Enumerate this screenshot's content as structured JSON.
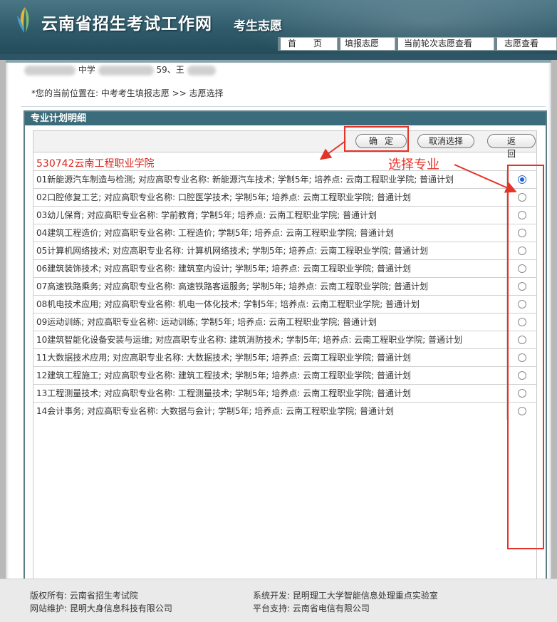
{
  "header": {
    "site_title": "云南省招生考试工作网",
    "site_subtitle": "考生志愿",
    "nav": [
      "首 页",
      "填报志愿",
      "当前轮次志愿查看",
      "志愿查看"
    ]
  },
  "user_line": {
    "school_fragment": "中学",
    "id_fragment": "59、王"
  },
  "breadcrumb": "*您的当前位置在: 中考考生填报志愿 >> 志愿选择",
  "panel_title": "专业计划明细",
  "buttons": {
    "confirm": "确定",
    "cancel": "取消选择",
    "back": "返回"
  },
  "school_name": "530742云南工程职业学院",
  "annotation": {
    "label": "选择专业",
    "color": "#e53327"
  },
  "majors": [
    {
      "text": "01新能源汽车制造与检测;    对应高职专业名称: 新能源汽车技术;       学制5年;      培养点: 云南工程职业学院;     普通计划",
      "checked": true
    },
    {
      "text": "02口腔修复工艺;        对应高职专业名称: 口腔医学技术;       学制5年;      培养点: 云南工程职业学院;      普通计划",
      "checked": false
    },
    {
      "text": "03幼儿保育;       对应高职专业名称: 学前教育;       学制5年;      培养点: 云南工程职业学院;      普通计划",
      "checked": false
    },
    {
      "text": "04建筑工程造价;       对应高职专业名称: 工程造价;       学制5年;      培养点: 云南工程职业学院;      普通计划",
      "checked": false
    },
    {
      "text": "05计算机网络技术;       对应高职专业名称: 计算机网络技术;       学制5年;      培养点: 云南工程职业学院;      普通计划",
      "checked": false
    },
    {
      "text": "06建筑装饰技术;        对应高职专业名称: 建筑室内设计;       学制5年;      培养点: 云南工程职业学院;      普通计划",
      "checked": false
    },
    {
      "text": "07高速铁路乘务;       对应高职专业名称: 高速铁路客运服务;       学制5年;      培养点: 云南工程职业学院;      普通计划",
      "checked": false
    },
    {
      "text": "08机电技术应用;       对应高职专业名称: 机电一体化技术;       学制5年;      培养点: 云南工程职业学院;      普通计划",
      "checked": false
    },
    {
      "text": "09运动训练;       对应高职专业名称: 运动训练;       学制5年;      培养点: 云南工程职业学院;      普通计划",
      "checked": false
    },
    {
      "text": "10建筑智能化设备安装与运维;     对应高职专业名称: 建筑消防技术;       学制5年;      培养点: 云南工程职业学院;      普通计划",
      "checked": false
    },
    {
      "text": "11大数据技术应用;       对应高职专业名称: 大数据技术;       学制5年;      培养点: 云南工程职业学院;      普通计划",
      "checked": false
    },
    {
      "text": "12建筑工程施工;        对应高职专业名称: 建筑工程技术;       学制5年;      培养点: 云南工程职业学院;      普通计划",
      "checked": false
    },
    {
      "text": "13工程测量技术;        对应高职专业名称: 工程测量技术;       学制5年;      培养点: 云南工程职业学院;      普通计划",
      "checked": false
    },
    {
      "text": "14会计事务;       对应高职专业名称: 大数据与会计;       学制5年;      培养点: 云南工程职业学院;      普通计划",
      "checked": false
    }
  ],
  "footer": {
    "copyright": "版权所有: 云南省招生考试院",
    "maintain": "网站维护: 昆明大身信息科技有限公司",
    "developer": "系统开发: 昆明理工大学智能信息处理重点实验室",
    "platform": "平台支持: 云南省电信有限公司"
  }
}
